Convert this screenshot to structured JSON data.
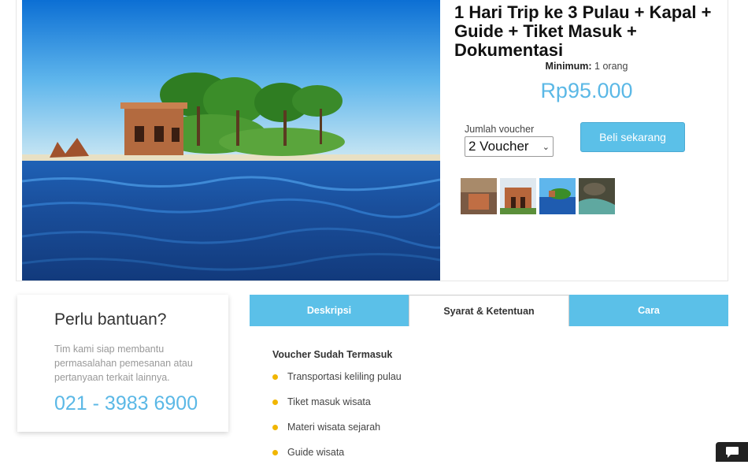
{
  "product": {
    "title": "1 Hari Trip ke 3 Pulau + Kapal + Guide + Tiket Masuk + Dokumentasi",
    "minimum_label": "Minimum:",
    "minimum_value": " 1 orang",
    "price": "Rp95.000",
    "quantity_label": "Jumlah voucher",
    "quantity_selected": "2 Voucher",
    "buy_label": "Beli sekarang"
  },
  "help": {
    "title": "Perlu bantuan?",
    "text": "Tim kami siap membantu permasalahan pemesanan atau pertanyaan terkait lainnya.",
    "phone": "021 - 3983 6900"
  },
  "tabs": [
    {
      "label": "Deskripsi"
    },
    {
      "label": "Syarat & Ketentuan"
    },
    {
      "label": "Cara"
    }
  ],
  "content": {
    "heading": "Voucher Sudah Termasuk",
    "items": [
      "Transportasi keliling pulau",
      "Tiket masuk wisata",
      "Materi wisata sejarah",
      "Guide wisata"
    ]
  },
  "icons": {
    "chat": "chat-bubble-icon",
    "select": "chevron-down-icon"
  },
  "colors": {
    "accent": "#5bc0e8",
    "price": "#5bb8e6",
    "bullet": "#f1b600"
  }
}
